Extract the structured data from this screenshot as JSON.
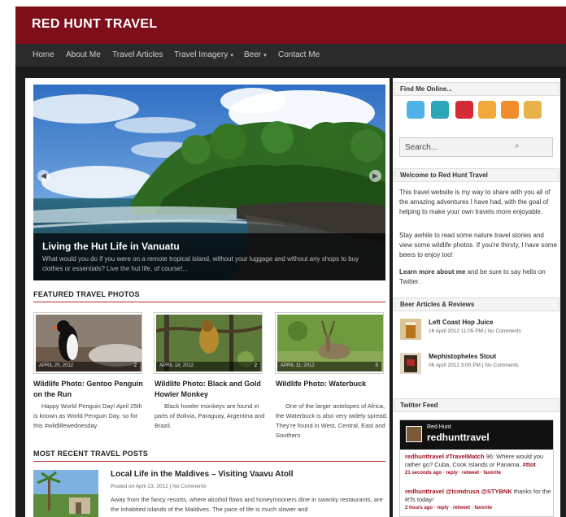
{
  "site": {
    "title": "RED HUNT TRAVEL",
    "brand_color": "#7e0f1a",
    "nav_color": "#2b2b2b"
  },
  "nav": {
    "items": [
      {
        "label": "Home",
        "dropdown": false
      },
      {
        "label": "About Me",
        "dropdown": false
      },
      {
        "label": "Travel Articles",
        "dropdown": false
      },
      {
        "label": "Travel Imagery",
        "dropdown": true
      },
      {
        "label": "Beer",
        "dropdown": true
      },
      {
        "label": "Contact Me",
        "dropdown": false
      }
    ],
    "caret": "▾"
  },
  "slider": {
    "title": "Living the Hut Life in Vanuatu",
    "text": "What would you do if you were on a remote tropical island, without your luggage and without any shops to buy clothes or essentials? Live the hut life, of course!...",
    "prev_icon": "◀",
    "next_icon": "▶"
  },
  "featured": {
    "heading": "FEATURED TRAVEL PHOTOS",
    "items": [
      {
        "date": "APRIL 25, 2012",
        "comments": "2",
        "title": "Wildlife Photo: Gentoo Penguin on the Run",
        "excerpt": "Happy World Penguin Day! April 25th is known as World Penguin Day, so for this #wildlifewednesday"
      },
      {
        "date": "APRIL 18, 2012",
        "comments": "2",
        "title": "Wildlife Photo: Black and Gold Howler Monkey",
        "excerpt": "Black howler monkeys are found in parts of Bolivia, Paraguay, Argentina and Brazil."
      },
      {
        "date": "APRIL 11, 2012",
        "comments": "0",
        "title": "Wildlife Photo: Waterbuck",
        "excerpt": "One of the larger antelopes of Africa, the Waterbuck is also very widely spread. They're found in West, Central, East and Southern"
      }
    ]
  },
  "recent": {
    "heading": "MOST RECENT TRAVEL POSTS",
    "items": [
      {
        "title": "Local Life in the Maldives – Visiting Vaavu Atoll",
        "meta": "Posted on April 23, 2012  |  No Comments",
        "text": "Away from the fancy resorts, where alcohol flows and honeymooners dine in swanky restaurants, are the inhabited islands of the Maldives. The pace of life is much slower and"
      }
    ]
  },
  "sidebar": {
    "find_me": {
      "title": "Find Me Online...",
      "icons": [
        {
          "name": "twitter-icon",
          "glyph": "t",
          "color": "#4fb3e8"
        },
        {
          "name": "stumbleupon-icon",
          "glyph": "SU",
          "color": "#2aa6b8"
        },
        {
          "name": "pinterest-icon",
          "glyph": "P",
          "color": "#d62a36"
        },
        {
          "name": "flickr-icon",
          "glyph": "✋",
          "color": "#f2a93b"
        },
        {
          "name": "rss-icon",
          "glyph": "◔",
          "color": "#f08d2d"
        },
        {
          "name": "email-icon",
          "glyph": "✉",
          "color": "#e9b24a"
        }
      ]
    },
    "search": {
      "placeholder": "Search...",
      "icon": "⌕"
    },
    "welcome": {
      "title": "Welcome to Red Hunt Travel",
      "p1": "This travel website is my way to share with you all of the amazing adventures I have had, with the goal of helping to make your own travels more enjoyable.",
      "p2": "Stay awhile to read some nature travel stories and view some wildlife photos. If you're thirsty, I have some beers to enjoy too!",
      "p3_link": "Learn more about me",
      "p3_rest": " and be sure to say hello on Twitter."
    },
    "beer": {
      "title": "Beer Articles & Reviews",
      "items": [
        {
          "title": "Left Coast Hop Juice",
          "meta": "16 April 2012 11:05 PM | No Comments"
        },
        {
          "title": "Mephistopheles Stout",
          "meta": "06 April 2012 3:00 PM | No Comments"
        }
      ]
    },
    "twitter": {
      "title": "Twitter Feed",
      "name": "Red Hunt",
      "handle": "redhunttravel",
      "tweets": [
        {
          "user": "redhunttravel",
          "text_a": " ",
          "tag1": "#TravelMatch",
          "text_b": " 96: Where would you rather go? Cuba, Cook Islands or Panama. ",
          "tag2": "#ttot",
          "meta": "21 seconds ago · reply · retweet · favorite"
        },
        {
          "user": "redhunttravel",
          "text_a": " ",
          "tag1": "@tcmdrusn @STYBNK",
          "text_b": " thanks for the RTs today!",
          "tag2": "",
          "meta": "2 hours ago · reply · retweet · favorite"
        }
      ]
    }
  }
}
